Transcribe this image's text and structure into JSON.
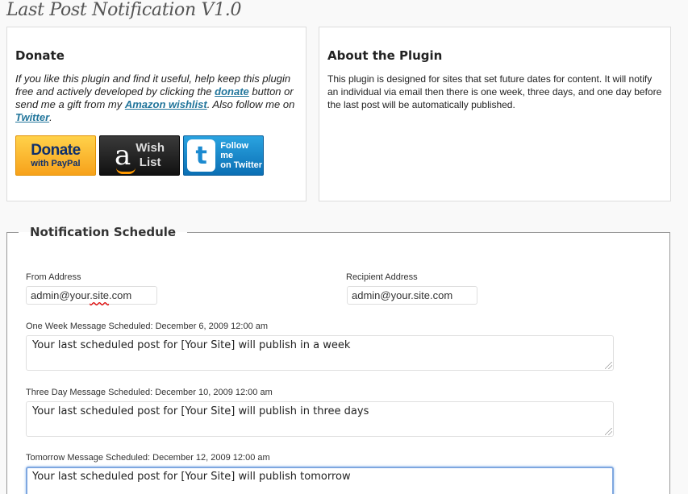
{
  "page": {
    "title": "Last Post Notification V1.0"
  },
  "donate": {
    "heading": "Donate",
    "text_1": "If you like this plugin and find it useful, help keep this plugin free and actively developed by clicking the ",
    "donate_link": "donate",
    "text_2": " button or send me a gift from my ",
    "wishlist_link": "Amazon wishlist",
    "text_3": ". Also follow me on ",
    "twitter_link": "Twitter",
    "text_4": ".",
    "paypal_big": "Donate",
    "paypal_small": "with PayPal",
    "amazon_letter": "a",
    "amazon_line1": "Wish",
    "amazon_line2": "List",
    "twitter_letter": "t",
    "twitter_line1": "Follow me",
    "twitter_line2": "on Twitter"
  },
  "about": {
    "heading": "About the Plugin",
    "text": "This plugin is designed for sites that set future dates for content. It will notify an individual via email then there is one week, three days, and one day before the last post will be automatically published."
  },
  "schedule": {
    "legend": "Notification Schedule",
    "from_label": "From Address",
    "from_value_a": "admin@your",
    "from_value_b": ".site",
    "from_value_c": ".com",
    "recipient_label": "Recipient Address",
    "recipient_value": "admin@your.site.com",
    "week_label": "One Week Message Scheduled: December 6, 2009 12:00 am",
    "week_message": "Your last scheduled post for [Your Site] will publish in a week",
    "three_label": "Three Day Message Scheduled: December 10, 2009 12:00 am",
    "three_message": "Your last scheduled post for [Your Site] will publish in three days",
    "tomorrow_label": "Tomorrow Message Scheduled: December 12, 2009 12:00 am",
    "tomorrow_message": "Your last scheduled post for [Your Site] will publish tomorrow"
  },
  "colors": {
    "link": "#21759b",
    "focus_border": "#7ea7e0",
    "paypal": "#f7a21b",
    "twitter": "#1b8ad0"
  }
}
